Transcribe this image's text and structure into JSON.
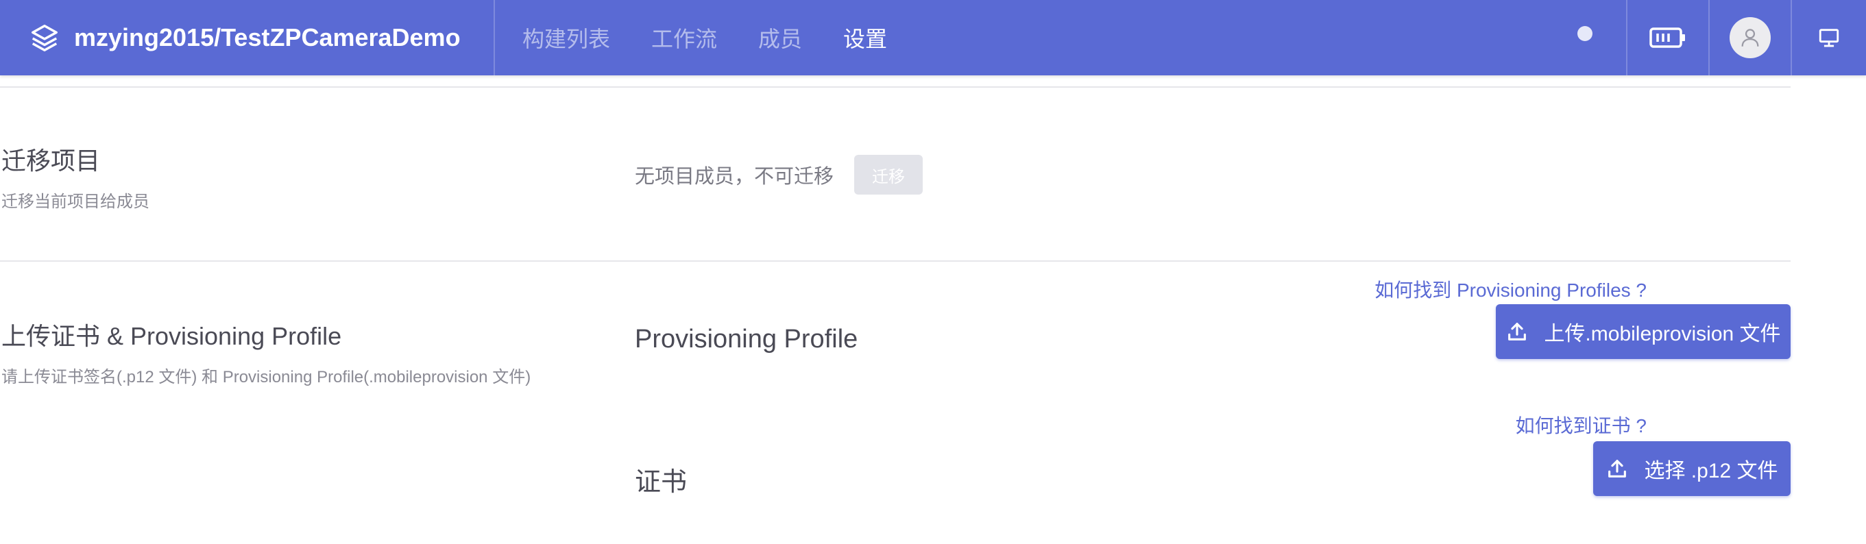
{
  "header": {
    "repo_title": "mzying2015/TestZPCameraDemo",
    "brand_icon": "layers-icon",
    "nav": [
      {
        "label": "构建列表",
        "active": false
      },
      {
        "label": "工作流",
        "active": false
      },
      {
        "label": "成员",
        "active": false
      },
      {
        "label": "设置",
        "active": true
      }
    ],
    "right_icons": [
      "status-dot",
      "battery-icon",
      "user-avatar-icon",
      "monitor-icon"
    ]
  },
  "migrate": {
    "title": "迁移项目",
    "description": "迁移当前项目给成员",
    "hint": "无项目成员，不可迁移",
    "button_label": "迁移",
    "button_disabled": true
  },
  "upload": {
    "title": "上传证书 & Provisioning Profile",
    "description": "请上传证书签名(.p12 文件) 和 Provisioning Profile(.mobileprovision 文件)",
    "profile": {
      "label": "Provisioning Profile",
      "help_link": "如何找到 Provisioning Profiles ?",
      "button_label": "上传.mobileprovision 文件"
    },
    "certificate": {
      "label": "证书",
      "help_link": "如何找到证书 ?",
      "button_label": "选择 .p12 文件"
    }
  },
  "colors": {
    "primary": "#5a6ad4",
    "disabled_button": "#e2e3e9",
    "divider": "#e6e6ea"
  }
}
